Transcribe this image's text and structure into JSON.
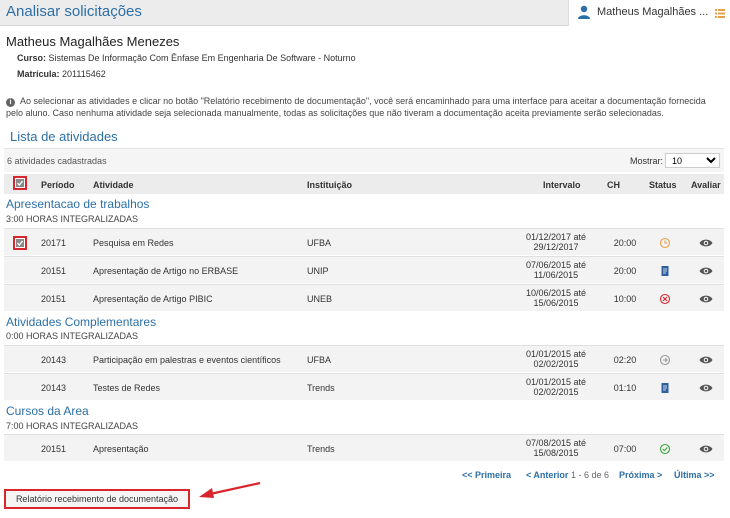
{
  "header": {
    "title": "Analisar solicitações",
    "user_name": "Matheus Magalhães ..."
  },
  "student": {
    "name": "Matheus Magalhães Menezes",
    "curso_label": "Curso:",
    "curso_value": "Sistemas De Informação Com Ênfase Em Engenharia De Software - Noturno",
    "matricula_label": "Matrícula:",
    "matricula_value": "201115462"
  },
  "notice": "Ao selecionar as atividades e clicar no botão \"Relatório recebimento de documentação\", você será encaminhado para uma interface para aceitar a documentação fornecida pelo aluno. Caso nenhuma atividade seja selecionada manualmente, todas as solicitações que não tiveram a documentação aceita previamente serão selecionadas.",
  "list_title": "Lista de atividades",
  "toolbar": {
    "count": "6 atividades cadastradas",
    "mostrar_label": "Mostrar:",
    "mostrar_value": "10"
  },
  "columns": {
    "periodo": "Período",
    "atividade": "Atividade",
    "instituicao": "Instituição",
    "intervalo": "Intervalo",
    "ch": "CH",
    "status": "Status",
    "avaliar": "Avaliar"
  },
  "groups": [
    {
      "title": "Apresentacao de trabalhos",
      "subtitle": "3:00 HORAS INTEGRALIZADAS",
      "rows": [
        {
          "code": "20171",
          "activity": "Pesquisa em Redes",
          "institution": "UFBA",
          "start": "01/12/2017 até",
          "end": "29/12/2017",
          "ch": "20:00",
          "status": "pending",
          "checked": true
        },
        {
          "code": "20151",
          "activity": "Apresentação de Artigo no ERBASE",
          "institution": "UNIP",
          "start": "07/06/2015 até",
          "end": "11/06/2015",
          "ch": "20:00",
          "status": "document",
          "checked": false
        },
        {
          "code": "20151",
          "activity": "Apresentação de Artigo PIBIC",
          "institution": "UNEB",
          "start": "10/06/2015 até",
          "end": "15/06/2015",
          "ch": "10:00",
          "status": "rejected",
          "checked": false
        }
      ]
    },
    {
      "title": "Atividades Complementares",
      "subtitle": "0:00 HORAS INTEGRALIZADAS",
      "rows": [
        {
          "code": "20143",
          "activity": "Participação em palestras e eventos científicos",
          "institution": "UFBA",
          "start": "01/01/2015 até",
          "end": "02/02/2015",
          "ch": "02:20",
          "status": "forwarded",
          "checked": false
        },
        {
          "code": "20143",
          "activity": "Testes de Redes",
          "institution": "Trends",
          "start": "01/01/2015 até",
          "end": "02/02/2015",
          "ch": "01:10",
          "status": "document",
          "checked": false
        }
      ]
    },
    {
      "title": "Cursos da Area",
      "subtitle": "7:00 HORAS INTEGRALIZADAS",
      "rows": [
        {
          "code": "20151",
          "activity": "Apresentação",
          "institution": "Trends",
          "start": "07/08/2015 até",
          "end": "15/08/2015",
          "ch": "07:00",
          "status": "approved",
          "checked": false
        }
      ]
    }
  ],
  "pager": {
    "first": "<< Primeira",
    "prev": "< Anterior",
    "info": "1 - 6 de 6",
    "next": "Próxima >",
    "last": "Última >>"
  },
  "doc_button": "Relatório recebimento de documentação",
  "colors": {
    "accent": "#2c6fa6",
    "highlight": "#d9262d",
    "status_pending": "#e8a04a",
    "status_rejected": "#d9262d",
    "status_approved": "#3aa53a",
    "status_document": "#2f5f9e",
    "status_forwarded": "#999999"
  }
}
